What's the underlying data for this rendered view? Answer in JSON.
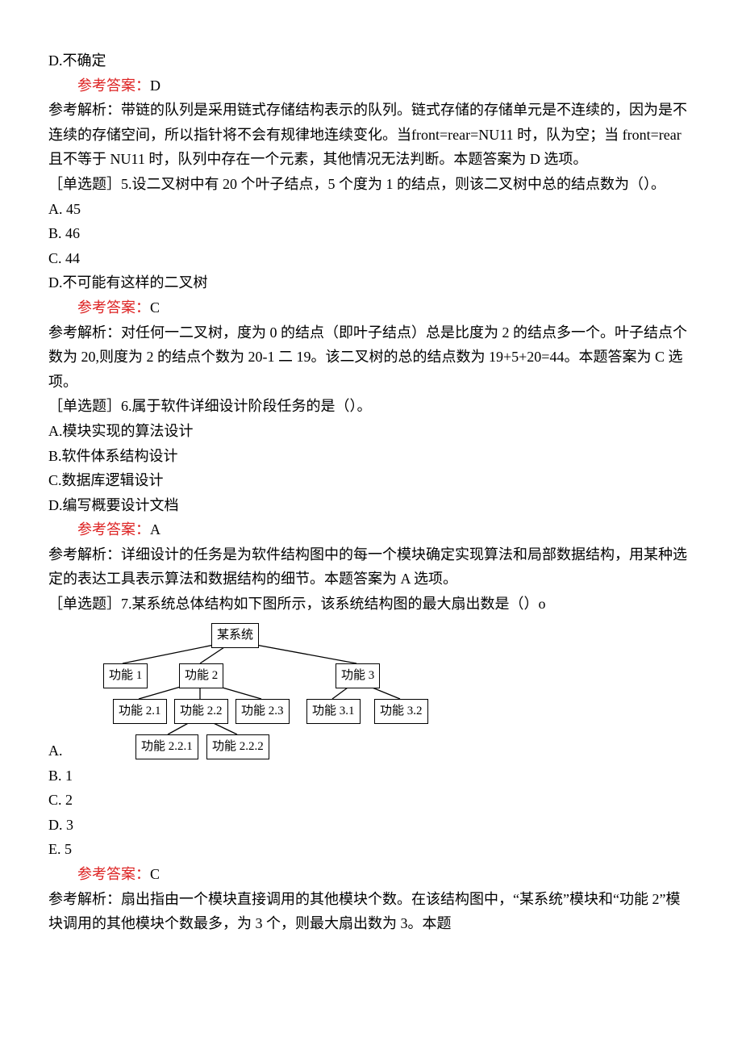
{
  "q4_optD": "D.不确定",
  "q4_ans_label": "参考答案：",
  "q4_ans_letter": "D",
  "q4_expl": "参考解析：带链的队列是采用链式存储结构表示的队列。链式存储的存储单元是不连续的，因为是不连续的存储空间，所以指针将不会有规律地连续变化。当front=rear=NU11 时，队为空；当 front=rear 且不等于 NU11 时，队列中存在一个元素，其他情况无法判断。本题答案为 D 选项。",
  "q5_stem": "［单选题］5.设二叉树中有 20 个叶子结点，5 个度为 1 的结点，则该二叉树中总的结点数为（）。",
  "q5_a": "A. 45",
  "q5_b": "B. 46",
  "q5_c": "C. 44",
  "q5_d": "D.不可能有这样的二叉树",
  "q5_ans_label": "参考答案：",
  "q5_ans_letter": "C",
  "q5_expl": "参考解析：对任何一二叉树，度为 0 的结点（即叶子结点）总是比度为 2 的结点多一个。叶子结点个数为 20,则度为 2 的结点个数为 20-1 二 19。该二叉树的总的结点数为 19+5+20=44。本题答案为 C 选项。",
  "q6_stem": "［单选题］6.属于软件详细设计阶段任务的是（）。",
  "q6_a": "A.模块实现的算法设计",
  "q6_b": "B.软件体系结构设计",
  "q6_c": "C.数据库逻辑设计",
  "q6_d": "D.编写概要设计文档",
  "q6_ans_label": "参考答案：",
  "q6_ans_letter": "A",
  "q6_expl": "参考解析：详细设计的任务是为软件结构图中的每一个模块确定实现算法和局部数据结构，用某种选定的表达工具表示算法和数据结构的细节。本题答案为 A 选项。",
  "q7_stem": "［单选题］7.某系统总体结构如下图所示，该系统结构图的最大扇出数是（）o",
  "q7_a": "A.",
  "q7_b": "B. 1",
  "q7_c": "C. 2",
  "q7_d": "D. 3",
  "q7_e": "E. 5",
  "q7_ans_label": "参考答案：",
  "q7_ans_letter": "C",
  "q7_expl": "参考解析：扇出指由一个模块直接调用的其他模块个数。在该结构图中，“某系统”模块和“功能 2”模块调用的其他模块个数最多，为 3 个，则最大扇出数为 3。本题",
  "diag": {
    "root": "某系统",
    "f1": "功能 1",
    "f2": "功能 2",
    "f3": "功能 3",
    "f21": "功能 2.1",
    "f22": "功能 2.2",
    "f23": "功能 2.3",
    "f31": "功能 3.1",
    "f32": "功能 3.2",
    "f221": "功能 2.2.1",
    "f222": "功能 2.2.2"
  }
}
